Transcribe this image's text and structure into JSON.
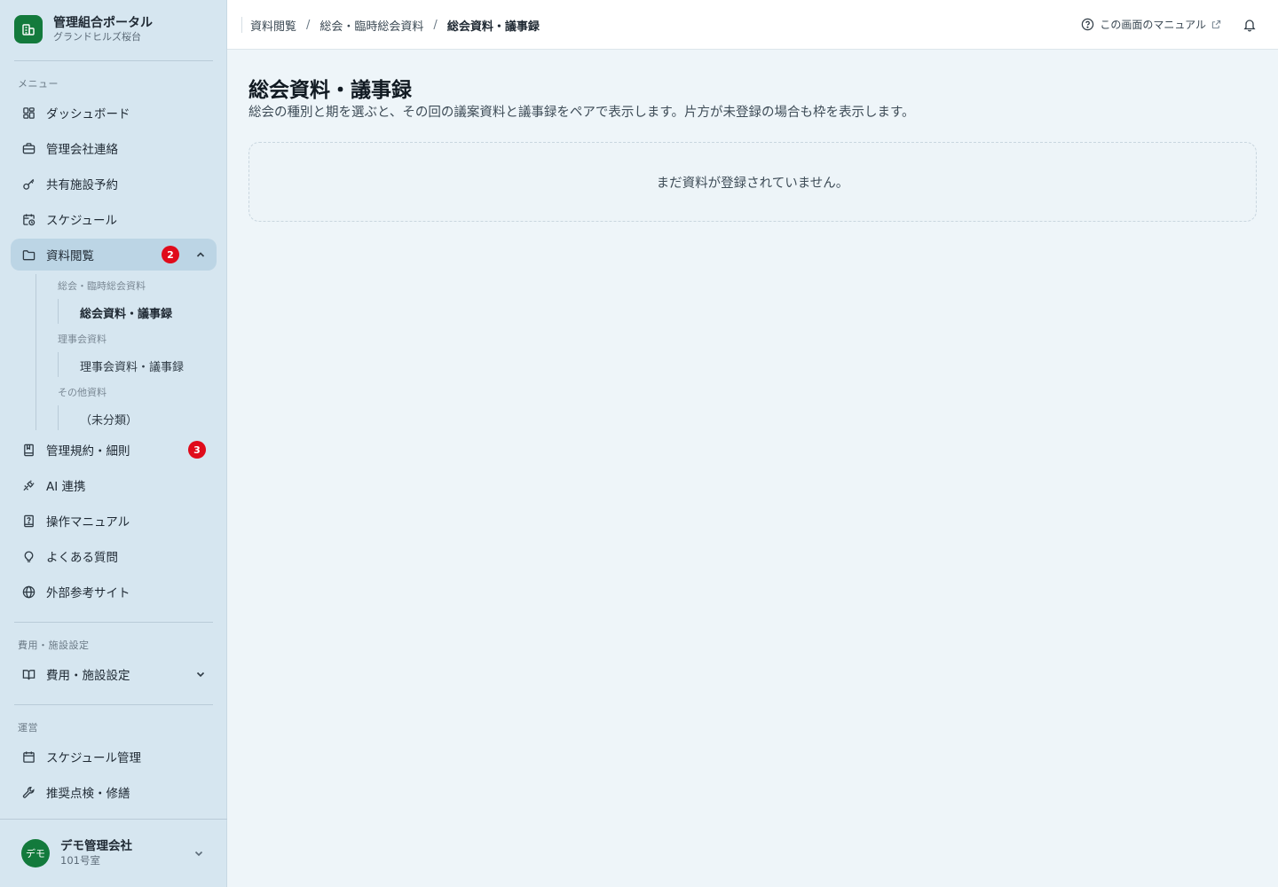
{
  "brand": {
    "title": "管理組合ポータル",
    "subtitle": "グランドヒルズ桜台",
    "icon": "building-icon",
    "color": "#137a3c"
  },
  "sidebar": {
    "menu_label": "メニュー",
    "items": [
      {
        "label": "ダッシュボード",
        "icon": "dashboard-icon"
      },
      {
        "label": "管理会社連絡",
        "icon": "briefcase-icon"
      },
      {
        "label": "共有施設予約",
        "icon": "key-icon"
      },
      {
        "label": "スケジュール",
        "icon": "calendar-clock-icon"
      },
      {
        "label": "資料閲覧",
        "icon": "folder-icon",
        "badge": "2",
        "expanded": true
      },
      {
        "label": "管理規約・細則",
        "icon": "book-icon",
        "badge": "3"
      },
      {
        "label": "AI 連携",
        "icon": "plug-icon"
      },
      {
        "label": "操作マニュアル",
        "icon": "help-book-icon"
      },
      {
        "label": "よくある質問",
        "icon": "lightbulb-icon"
      },
      {
        "label": "外部参考サイト",
        "icon": "globe-icon"
      }
    ],
    "documents_sub": [
      {
        "group": "総会・臨時総会資料",
        "link": "総会資料・議事録",
        "active": true
      },
      {
        "group": "理事会資料",
        "link": "理事会資料・議事録",
        "active": false
      },
      {
        "group": "その他資料",
        "link": "（未分類）",
        "active": false
      }
    ],
    "facility_section_label": "費用・施設設定",
    "facility_item": {
      "label": "費用・施設設定",
      "icon": "open-book-icon"
    },
    "ops_section_label": "運営",
    "ops_items": [
      {
        "label": "スケジュール管理",
        "icon": "calendar-icon"
      },
      {
        "label": "推奨点検・修繕",
        "icon": "wrench-icon"
      }
    ],
    "badge_color": "#e00b1b"
  },
  "user": {
    "avatar_text": "デモ",
    "name": "デモ管理会社",
    "room": "101号室"
  },
  "header": {
    "breadcrumb": [
      "資料閲覧",
      "総会・臨時総会資料",
      "総会資料・議事録"
    ],
    "breadcrumb_sep": "/",
    "manual_link": "この画面のマニュアル",
    "bell_icon": "bell-icon"
  },
  "main": {
    "title": "総会資料・議事録",
    "description": "総会の種別と期を選ぶと、その回の議案資料と議事録をペアで表示します。片方が未登録の場合も枠を表示します。",
    "empty_message": "まだ資料が登録されていません。"
  }
}
